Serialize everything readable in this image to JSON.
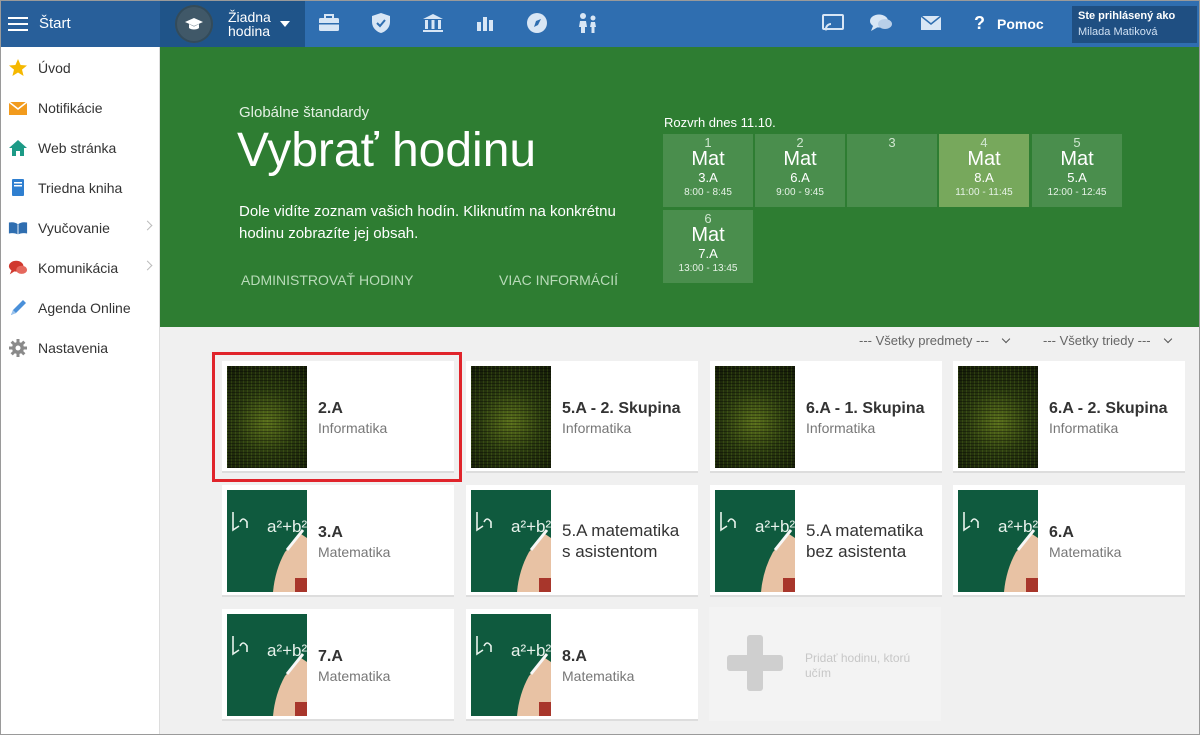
{
  "topbar": {
    "start_label": "Štart",
    "lesson_selector": "Žiadna hodina",
    "icons": [
      "briefcase-icon",
      "shield-check-icon",
      "institution-icon",
      "bar-chart-icon",
      "compass-icon",
      "students-icon",
      "cast-icon",
      "chat-icon",
      "mail-icon"
    ],
    "help_label": "Pomoc",
    "user": {
      "label": "Ste prihlásený ako",
      "name": "Milada Matiková"
    }
  },
  "sidebar": {
    "items": [
      {
        "label": "Úvod",
        "icon": "star-icon"
      },
      {
        "label": "Notifikácie",
        "icon": "envelope-icon"
      },
      {
        "label": "Web stránka",
        "icon": "house-icon"
      },
      {
        "label": "Triedna kniha",
        "icon": "book-icon"
      },
      {
        "label": "Vyučovanie",
        "icon": "open-book-icon"
      },
      {
        "label": "Komunikácia",
        "icon": "chat-bubbles-icon"
      },
      {
        "label": "Agenda Online",
        "icon": "pencil-icon"
      },
      {
        "label": "Nastavenia",
        "icon": "gear-icon"
      }
    ]
  },
  "hero": {
    "subtitle": "Globálne štandardy",
    "title": "Vybrať hodinu",
    "description": "Dole vidíte zoznam vašich hodín. Kliknutím na konkrétnu hodinu zobrazíte jej obsah.",
    "link_admin": "ADMINISTROVAŤ HODINY",
    "link_info": "VIAC INFORMÁCIÍ"
  },
  "schedule": {
    "title": "Rozvrh dnes 11.10.",
    "slots": [
      {
        "num": "1",
        "subject": "Mat",
        "class": "3.A",
        "time": "8:00 - 8:45",
        "active": false
      },
      {
        "num": "2",
        "subject": "Mat",
        "class": "6.A",
        "time": "9:00 - 9:45",
        "active": false
      },
      {
        "num": "3",
        "subject": "",
        "class": "",
        "time": "",
        "active": false
      },
      {
        "num": "4",
        "subject": "Mat",
        "class": "8.A",
        "time": "11:00 - 11:45",
        "active": true
      },
      {
        "num": "5",
        "subject": "Mat",
        "class": "5.A",
        "time": "12:00 - 12:45",
        "active": false
      },
      {
        "num": "6",
        "subject": "Mat",
        "class": "7.A",
        "time": "13:00 - 13:45",
        "active": false
      }
    ]
  },
  "filters": {
    "subjects": "--- Všetky predmety ---",
    "classes": "--- Všetky triedy ---"
  },
  "cards": [
    {
      "title": "2.A",
      "subtitle": "Informatika",
      "thumb": "matrix"
    },
    {
      "title": "5.A - 2. Skupina",
      "subtitle": "Informatika",
      "thumb": "matrix"
    },
    {
      "title": "6.A - 1. Skupina",
      "subtitle": "Informatika",
      "thumb": "matrix"
    },
    {
      "title": "6.A - 2. Skupina",
      "subtitle": "Informatika",
      "thumb": "matrix"
    },
    {
      "title": "3.A",
      "subtitle": "Matematika",
      "thumb": "chalkboard"
    },
    {
      "title": "5.A matematika s asistentom",
      "subtitle": "",
      "thumb": "chalkboard"
    },
    {
      "title": "5.A matematika bez asistenta",
      "subtitle": "",
      "thumb": "chalkboard"
    },
    {
      "title": "6.A",
      "subtitle": "Matematika",
      "thumb": "chalkboard"
    },
    {
      "title": "7.A",
      "subtitle": "Matematika",
      "thumb": "chalkboard"
    },
    {
      "title": "8.A",
      "subtitle": "Matematika",
      "thumb": "chalkboard"
    }
  ],
  "add_card": {
    "label": "Pridať hodinu, ktorú učím"
  },
  "colors": {
    "topbar": "#2f6eb0",
    "hero": "#2e7d32",
    "highlight": "#e0242b"
  }
}
